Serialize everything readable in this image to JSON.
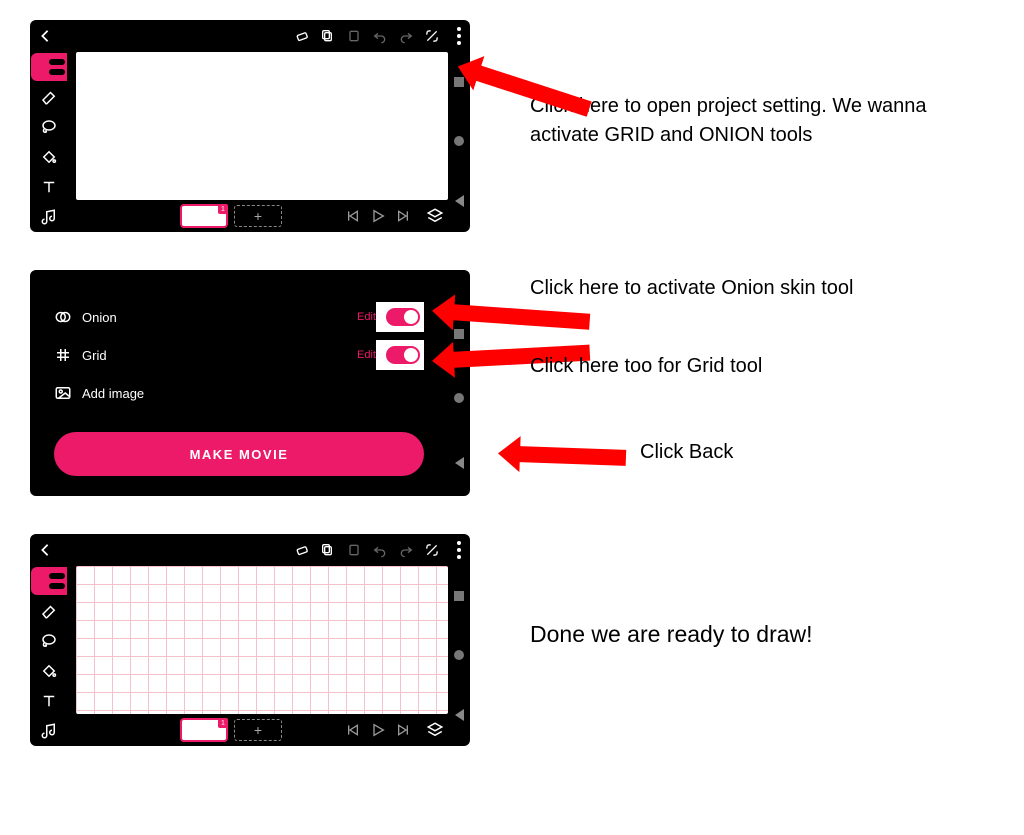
{
  "annotations": {
    "step1": "Click here to open project setting. We wanna activate GRID and ONION tools",
    "onion": "Click here to activate Onion skin tool",
    "grid": "Click here too for Grid tool",
    "back": "Click Back",
    "done": "Done we are ready to draw!"
  },
  "settings": {
    "onion_label": "Onion",
    "grid_label": "Grid",
    "add_image_label": "Add image",
    "edit": "Edit",
    "make_movie": "MAKE MOVIE"
  },
  "timeline": {
    "add_frame": "+"
  }
}
